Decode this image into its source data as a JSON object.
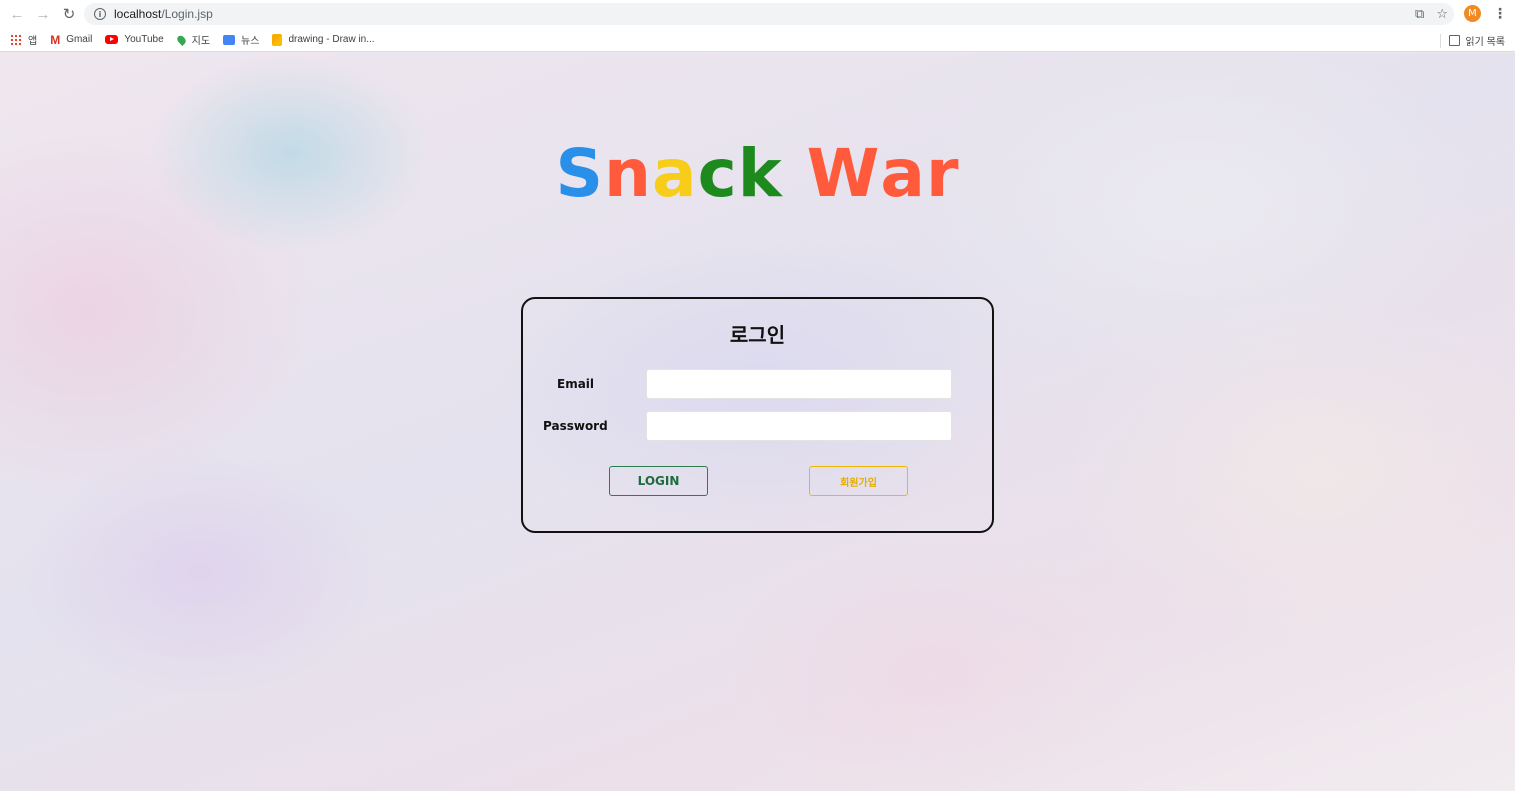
{
  "browser": {
    "url_host": "localhost",
    "url_path": "/Login.jsp",
    "avatar_letter": "M",
    "bookmarks": [
      {
        "label": "앱",
        "icon": "apps-grid-icon"
      },
      {
        "label": "Gmail",
        "icon": "gmail-icon"
      },
      {
        "label": "YouTube",
        "icon": "youtube-icon"
      },
      {
        "label": "지도",
        "icon": "maps-icon"
      },
      {
        "label": "뉴스",
        "icon": "news-icon"
      },
      {
        "label": "drawing - Draw in...",
        "icon": "drawing-icon"
      }
    ],
    "reading_list_label": "읽기 목록"
  },
  "logo": {
    "letters": [
      {
        "char": "S",
        "color": "#2a8fe8"
      },
      {
        "char": "n",
        "color": "#ff5a3c"
      },
      {
        "char": "a",
        "color": "#f7cd1a"
      },
      {
        "char": "c",
        "color": "#1e8a1e"
      },
      {
        "char": "k",
        "color": "#1e8a1e"
      },
      {
        "char": " ",
        "color": "#ff5a3c"
      },
      {
        "char": "W",
        "color": "#ff5a3c"
      },
      {
        "char": "a",
        "color": "#ff5a3c"
      },
      {
        "char": "r",
        "color": "#ff5a3c"
      }
    ]
  },
  "login": {
    "title": "로그인",
    "email_label": "Email",
    "email_value": "",
    "password_label": "Password",
    "password_value": "",
    "login_button": "LOGIN",
    "signup_button": "회원가입"
  },
  "colors": {
    "login_button": "#2e7d4f",
    "signup_button": "#f0b800"
  }
}
